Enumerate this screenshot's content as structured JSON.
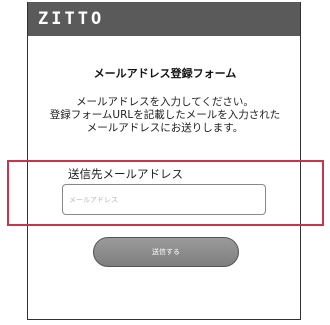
{
  "header": {
    "logo_text": "ZITTO"
  },
  "form": {
    "title": "メールアドレス登録フォーム",
    "description": [
      "メールアドレスを入力してください。",
      "登録フォームURLを記載したメールを入力された",
      "メールアドレスにお送りします。"
    ],
    "email_label": "送信先メールアドレス",
    "email_placeholder": "メールアドレス",
    "email_value": "",
    "submit_label": "送信する"
  },
  "colors": {
    "header_bg": "#5a5a5a",
    "highlight_border": "#c8344a",
    "button_bg": "#8c8c8c"
  }
}
